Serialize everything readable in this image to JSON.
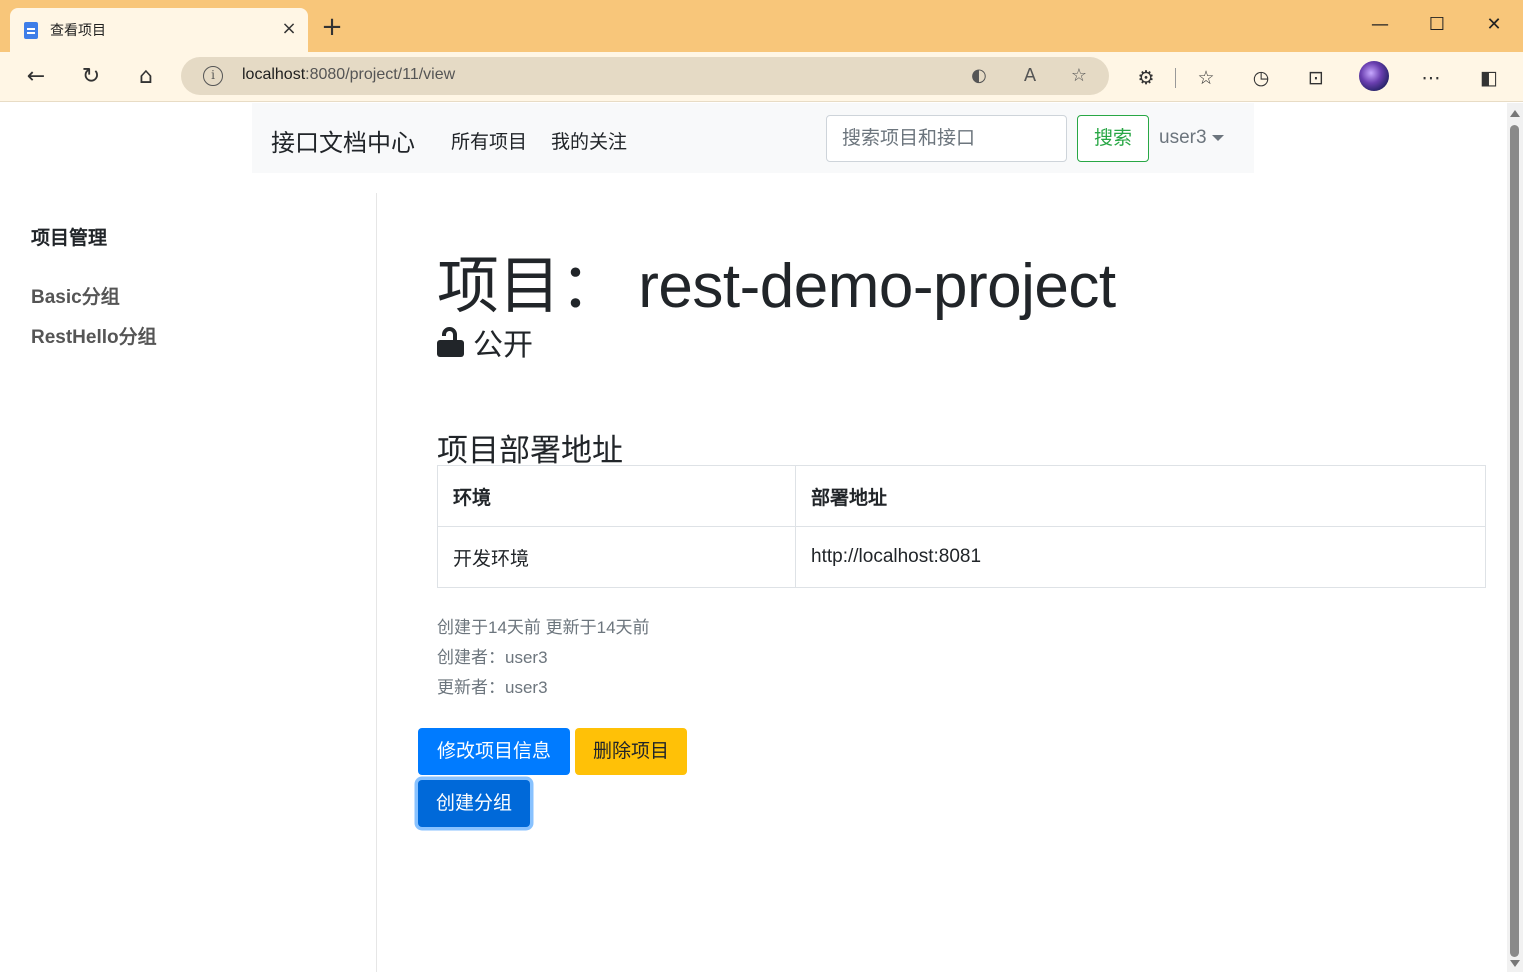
{
  "browser": {
    "tab_title": "查看项目",
    "tab_close": "×",
    "new_tab": "+",
    "url_host": "localhost",
    "url_path": ":8080/project/11/view",
    "window_controls": {
      "minimize": "—",
      "maximize": "☐",
      "close": "✕"
    }
  },
  "navbar": {
    "brand": "接口文档中心",
    "links": [
      "所有项目",
      "我的关注"
    ],
    "search_placeholder": "搜索项目和接口",
    "search_button": "搜索",
    "user": "user3"
  },
  "sidebar": {
    "heading": "项目管理",
    "items": [
      "Basic分组",
      "RestHello分组"
    ]
  },
  "project": {
    "title": "项目： rest-demo-project",
    "visibility": "公开",
    "visibility_icon": "unlock-icon",
    "deploy_section_title": "项目部署地址",
    "table": {
      "headers": [
        "环境",
        "部署地址"
      ],
      "rows": [
        [
          "开发环境",
          "http://localhost:8081"
        ]
      ]
    },
    "meta": {
      "timestamps": "创建于14天前 更新于14天前",
      "created_by": "创建者：user3",
      "updated_by": "更新者：user3"
    },
    "actions": {
      "edit": "修改项目信息",
      "delete": "删除项目",
      "create_group": "创建分组"
    }
  },
  "colors": {
    "titlebar": "#f8c67a",
    "toolbar": "#fff6e5",
    "primary": "#007bff",
    "warning": "#ffc107",
    "success": "#28a745"
  }
}
